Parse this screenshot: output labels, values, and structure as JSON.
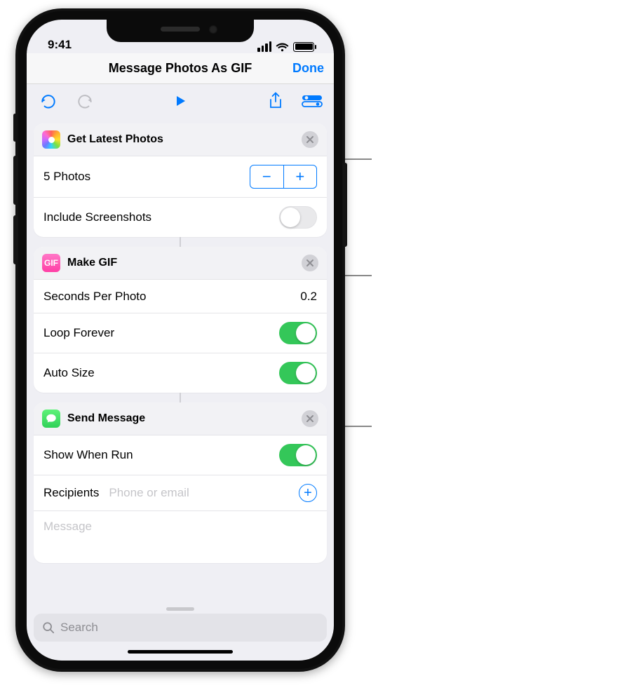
{
  "status": {
    "time": "9:41"
  },
  "nav": {
    "title": "Message Photos As GIF",
    "done": "Done"
  },
  "actions": [
    {
      "id": "get_latest_photos",
      "title": "Get Latest Photos",
      "icon": "photos",
      "rows": {
        "count_label": "5 Photos",
        "include_screenshots_label": "Include Screenshots",
        "include_screenshots": false
      }
    },
    {
      "id": "make_gif",
      "title": "Make GIF",
      "icon": "gif",
      "rows": {
        "seconds_label": "Seconds Per Photo",
        "seconds_value": "0.2",
        "loop_label": "Loop Forever",
        "loop": true,
        "autosize_label": "Auto Size",
        "autosize": true
      }
    },
    {
      "id": "send_message",
      "title": "Send Message",
      "icon": "messages",
      "rows": {
        "show_when_run_label": "Show When Run",
        "show_when_run": true,
        "recipients_label": "Recipients",
        "recipients_placeholder": "Phone or email",
        "message_placeholder": "Message"
      }
    }
  ],
  "search": {
    "placeholder": "Search"
  }
}
